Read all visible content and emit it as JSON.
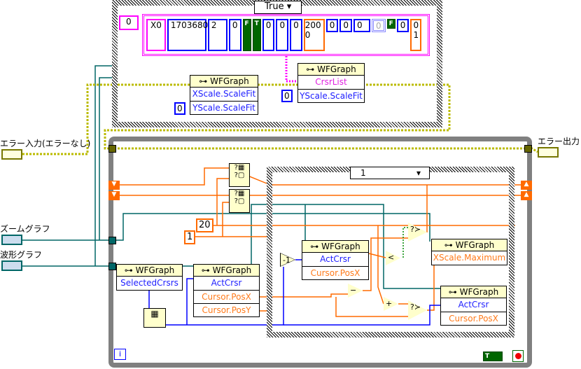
{
  "top_case": {
    "selector": "True",
    "index_const": "0",
    "cluster": [
      "X0",
      "1703680",
      "2",
      "0",
      "F",
      "T",
      "0",
      "0",
      "0",
      "0",
      "0",
      "0",
      "0",
      "0"
    ],
    "orange_array_a": [
      "200",
      "0"
    ],
    "orange_array_b": [
      "0",
      "1"
    ],
    "node1": {
      "title": "WFGraph",
      "rows": [
        "XScale.ScaleFit",
        "YScale.ScaleFit"
      ],
      "const": "0"
    },
    "node2": {
      "title": "WFGraph",
      "rows": [
        "CrsrList",
        "YScale.ScaleFit"
      ],
      "const": "0"
    }
  },
  "terminals": {
    "error_in": "エラー入力(エラーなし)",
    "error_out": "エラー出力",
    "zoom_graph": "ズームグラフ",
    "waveform_graph": "波形グラフ"
  },
  "loop": {
    "case_selector": "1",
    "const_20": "20",
    "const_1": "1",
    "iteration": "i",
    "stop_bool": "T",
    "n_sel": {
      "title": "WFGraph",
      "rows": [
        "SelectedCrsrs"
      ]
    },
    "n_act": {
      "title": "WFGraph",
      "rows": [
        "ActCrsr",
        "Cursor.PosX",
        "Cursor.PosY"
      ]
    },
    "n_in1": {
      "title": "WFGraph",
      "rows": [
        "ActCrsr",
        "Cursor.PosX"
      ]
    },
    "n_max": {
      "title": "WFGraph",
      "rows": [
        "XScale.Maximum"
      ]
    },
    "n_in2": {
      "title": "WFGraph",
      "rows": [
        "ActCrsr",
        "Cursor.PosX"
      ]
    },
    "neg1": "-1",
    "lt": "<",
    "minus": "−",
    "plus": "+"
  },
  "colors": {
    "numeric_wire": "#ff6a00",
    "ref_wire": "#006666",
    "int_wire": "#0000ff",
    "error_wire": "#cccc00",
    "cluster_wire": "#ff00ff"
  }
}
